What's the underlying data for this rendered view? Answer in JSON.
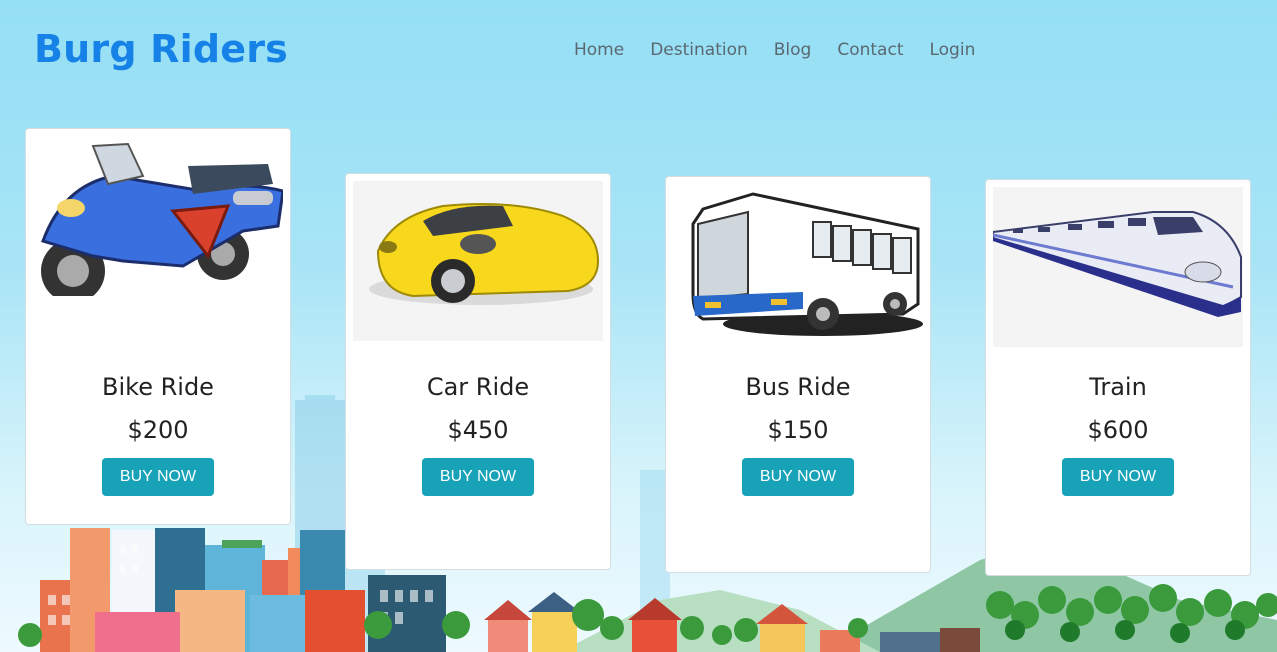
{
  "header": {
    "brand": "Burg Riders",
    "nav": [
      "Home",
      "Destination",
      "Blog",
      "Contact",
      "Login"
    ]
  },
  "cards": [
    {
      "title": "Bike Ride",
      "price": "$200",
      "button": "BUY NOW",
      "icon": "motorcycle-icon"
    },
    {
      "title": "Car Ride",
      "price": "$450",
      "button": "BUY NOW",
      "icon": "car-icon"
    },
    {
      "title": "Bus Ride",
      "price": "$150",
      "button": "BUY NOW",
      "icon": "bus-icon"
    },
    {
      "title": "Train",
      "price": "$600",
      "button": "BUY NOW",
      "icon": "train-icon"
    }
  ],
  "colors": {
    "brand": "#1682e8",
    "button": "#17a2b8",
    "sky": "#95dff5"
  }
}
